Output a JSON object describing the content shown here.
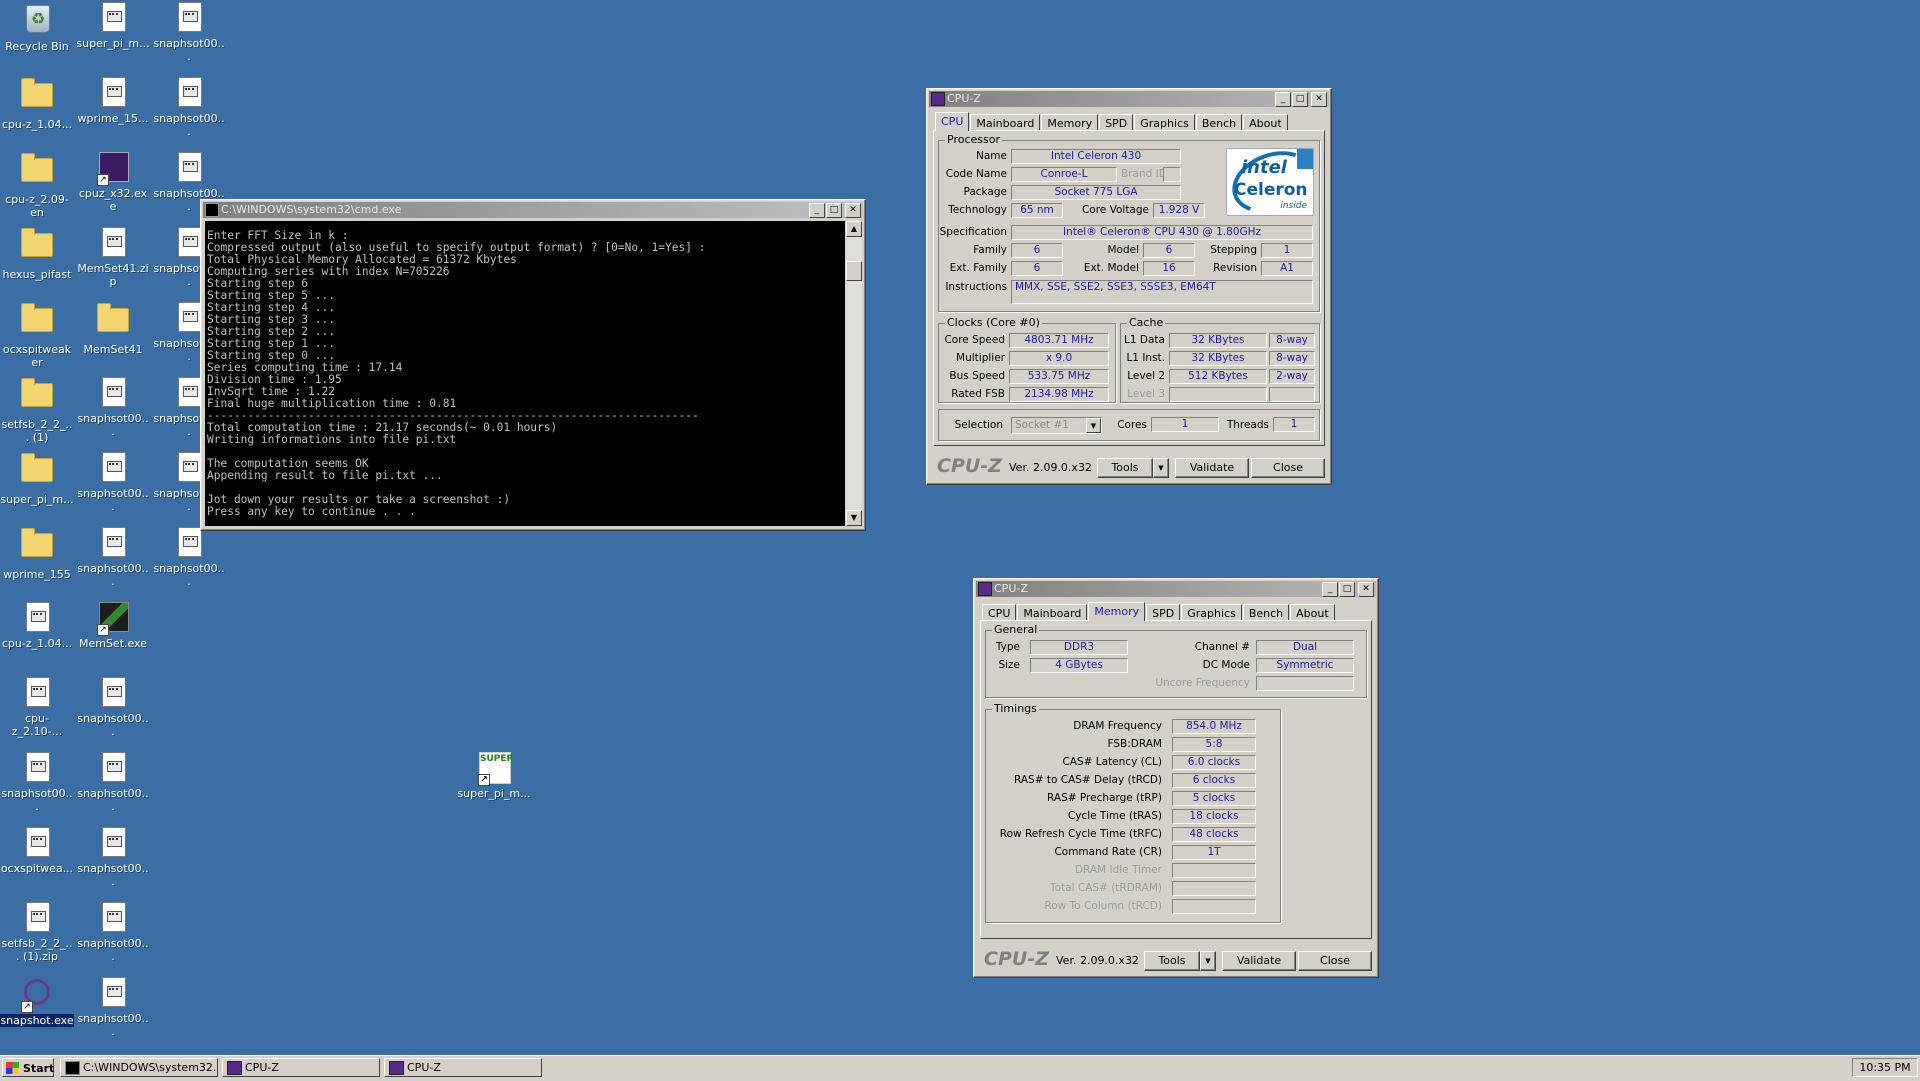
{
  "desktop_icons": [
    {
      "label": "Recycle Bin",
      "type": "recycle"
    },
    {
      "label": "super_pi_m...",
      "type": "file"
    },
    {
      "label": "snaphsot00...",
      "type": "file"
    },
    {
      "label": "cpu-z_1.04...",
      "type": "folder"
    },
    {
      "label": "wprime_15...",
      "type": "file"
    },
    {
      "label": "snaphsot00...",
      "type": "file"
    },
    {
      "label": "cpu-z_2.09-en",
      "type": "folder"
    },
    {
      "label": "cpuz_x32.exe",
      "type": "exe"
    },
    {
      "label": "snaphsot00...",
      "type": "file"
    },
    {
      "label": "hexus_pifast",
      "type": "folder"
    },
    {
      "label": "MemSet41.zip",
      "type": "file"
    },
    {
      "label": "snaphsot00...",
      "type": "file"
    },
    {
      "label": "ocxspitweaker",
      "type": "folder"
    },
    {
      "label": "MemSet41",
      "type": "folder"
    },
    {
      "label": "snaphsot00...",
      "type": "file"
    },
    {
      "label": "setfsb_2_2_... (1)",
      "type": "folder"
    },
    {
      "label": "snaphsot00...",
      "type": "file"
    },
    {
      "label": "snaphsot00...",
      "type": "file"
    },
    {
      "label": "super_pi_m...",
      "type": "folder"
    },
    {
      "label": "snaphsot00...",
      "type": "file"
    },
    {
      "label": "snaphsot00...",
      "type": "file"
    },
    {
      "label": "wprime_155",
      "type": "folder"
    },
    {
      "label": "snaphsot00...",
      "type": "file"
    },
    {
      "label": "snaphsot00...",
      "type": "file"
    },
    {
      "label": "cpu-z_1.04...",
      "type": "file"
    },
    {
      "label": "MemSet.exe",
      "type": "exe"
    },
    {
      "label": "cpu-z_2.10-...",
      "type": "file"
    },
    {
      "label": "snaphsot00...",
      "type": "file"
    },
    {
      "label": "snaphsot00...",
      "type": "file"
    },
    {
      "label": "snaphsot00...",
      "type": "file"
    },
    {
      "label": "ocxspitwea...",
      "type": "file"
    },
    {
      "label": "snaphsot00...",
      "type": "file"
    },
    {
      "label": "setfsb_2_2_... (1).zip",
      "type": "file"
    },
    {
      "label": "snaphsot00...",
      "type": "file"
    },
    {
      "label": "snapshot.exe",
      "type": "exe"
    },
    {
      "label": "snaphsot00...",
      "type": "file"
    },
    {
      "label": "super_pi_m...",
      "type": "exe"
    }
  ],
  "cmd_window": {
    "title": "C:\\WINDOWS\\system32\\cmd.exe",
    "lines": [
      "Enter FFT Size in k :",
      "Compressed output (also useful to specify output format) ? [0=No, 1=Yes] :",
      "Total Physical Memory Allocated = 61372 Kbytes",
      "Computing series with index N=705226",
      "Starting step 6",
      "Starting step 5 ...",
      "Starting step 4 ...",
      "Starting step 3 ...",
      "Starting step 2 ...",
      "Starting step 1 ...",
      "Starting step 0 ...",
      "Series computing time : 17.14",
      "Division time : 1.95",
      "InvSqrt time : 1.22",
      "Final huge multiplication time : 0.81",
      "-------------------------------------------------------------------------",
      "Total computation time : 21.17 seconds(~ 0.01 hours)",
      "Writing informations into file pi.txt",
      "",
      "The computation seems OK",
      "Appending result to file pi.txt ...",
      "",
      "Jot down your results or take a screenshot :)",
      "Press any key to continue . . ."
    ]
  },
  "cpuz_cpu": {
    "title": "CPU-Z",
    "tabs": [
      "CPU",
      "Mainboard",
      "Memory",
      "SPD",
      "Graphics",
      "Bench",
      "About"
    ],
    "active_tab": "CPU",
    "processor_group": "Processor",
    "name_label": "Name",
    "name": "Intel Celeron 430",
    "codename_label": "Code Name",
    "codename": "Conroe-L",
    "brandid_label": "Brand ID",
    "package_label": "Package",
    "package": "Socket 775 LGA",
    "technology_label": "Technology",
    "technology": "65 nm",
    "core_voltage_label": "Core Voltage",
    "core_voltage": "1.928 V",
    "spec_label": "Specification",
    "spec": "Intel® Celeron® CPU        430  @ 1.80GHz",
    "family_label": "Family",
    "family": "6",
    "model_label": "Model",
    "model": "6",
    "stepping_label": "Stepping",
    "stepping": "1",
    "extfamily_label": "Ext. Family",
    "extfamily": "6",
    "extmodel_label": "Ext. Model",
    "extmodel": "16",
    "revision_label": "Revision",
    "revision": "A1",
    "instructions_label": "Instructions",
    "instructions": "MMX, SSE, SSE2, SSE3, SSSE3, EM64T",
    "logo": {
      "brand": "intel",
      "product": "Celeron",
      "tag": "inside"
    },
    "clocks_group": "Clocks (Core #0)",
    "core_speed_label": "Core Speed",
    "core_speed": "4803.71 MHz",
    "multiplier_label": "Multiplier",
    "multiplier": "x 9.0",
    "bus_speed_label": "Bus Speed",
    "bus_speed": "533.75 MHz",
    "rated_fsb_label": "Rated FSB",
    "rated_fsb": "2134.98 MHz",
    "cache_group": "Cache",
    "l1data_label": "L1 Data",
    "l1data": "32 KBytes",
    "l1data_way": "8-way",
    "l1inst_label": "L1 Inst.",
    "l1inst": "32 KBytes",
    "l1inst_way": "8-way",
    "level2_label": "Level 2",
    "level2": "512 KBytes",
    "level2_way": "2-way",
    "level3_label": "Level 3",
    "selection_label": "Selection",
    "selection": "Socket #1",
    "cores_label": "Cores",
    "cores": "1",
    "threads_label": "Threads",
    "threads": "1",
    "logo_text": "CPU-Z",
    "version": "Ver. 2.09.0.x32",
    "tools": "Tools",
    "validate": "Validate",
    "close": "Close"
  },
  "cpuz_mem": {
    "title": "CPU-Z",
    "tabs": [
      "CPU",
      "Mainboard",
      "Memory",
      "SPD",
      "Graphics",
      "Bench",
      "About"
    ],
    "active_tab": "Memory",
    "general_group": "General",
    "type_label": "Type",
    "type": "DDR3",
    "size_label": "Size",
    "size": "4 GBytes",
    "channel_label": "Channel #",
    "channel": "Dual",
    "dcmode_label": "DC Mode",
    "dcmode": "Symmetric",
    "uncore_label": "Uncore Frequency",
    "timings_group": "Timings",
    "dram_freq_label": "DRAM Frequency",
    "dram_freq": "854.0 MHz",
    "fsbdram_label": "FSB:DRAM",
    "fsbdram": "5:8",
    "cl_label": "CAS# Latency (CL)",
    "cl": "6.0 clocks",
    "trcd_label": "RAS# to CAS# Delay (tRCD)",
    "trcd": "6 clocks",
    "trp_label": "RAS# Precharge (tRP)",
    "trp": "5 clocks",
    "tras_label": "Cycle Time (tRAS)",
    "tras": "18 clocks",
    "trfc_label": "Row Refresh Cycle Time (tRFC)",
    "trfc": "48 clocks",
    "cr_label": "Command Rate (CR)",
    "cr": "1T",
    "idle_label": "DRAM Idle Timer",
    "trdram_label": "Total CAS# (tRDRAM)",
    "rcd_label": "Row To Column (tRCD)",
    "logo_text": "CPU-Z",
    "version": "Ver. 2.09.0.x32",
    "tools": "Tools",
    "validate": "Validate",
    "close": "Close"
  },
  "taskbar": {
    "start": "Start",
    "tasks": [
      "C:\\WINDOWS\\system32...",
      "CPU-Z",
      "CPU-Z"
    ],
    "clock": "10:35 PM"
  }
}
